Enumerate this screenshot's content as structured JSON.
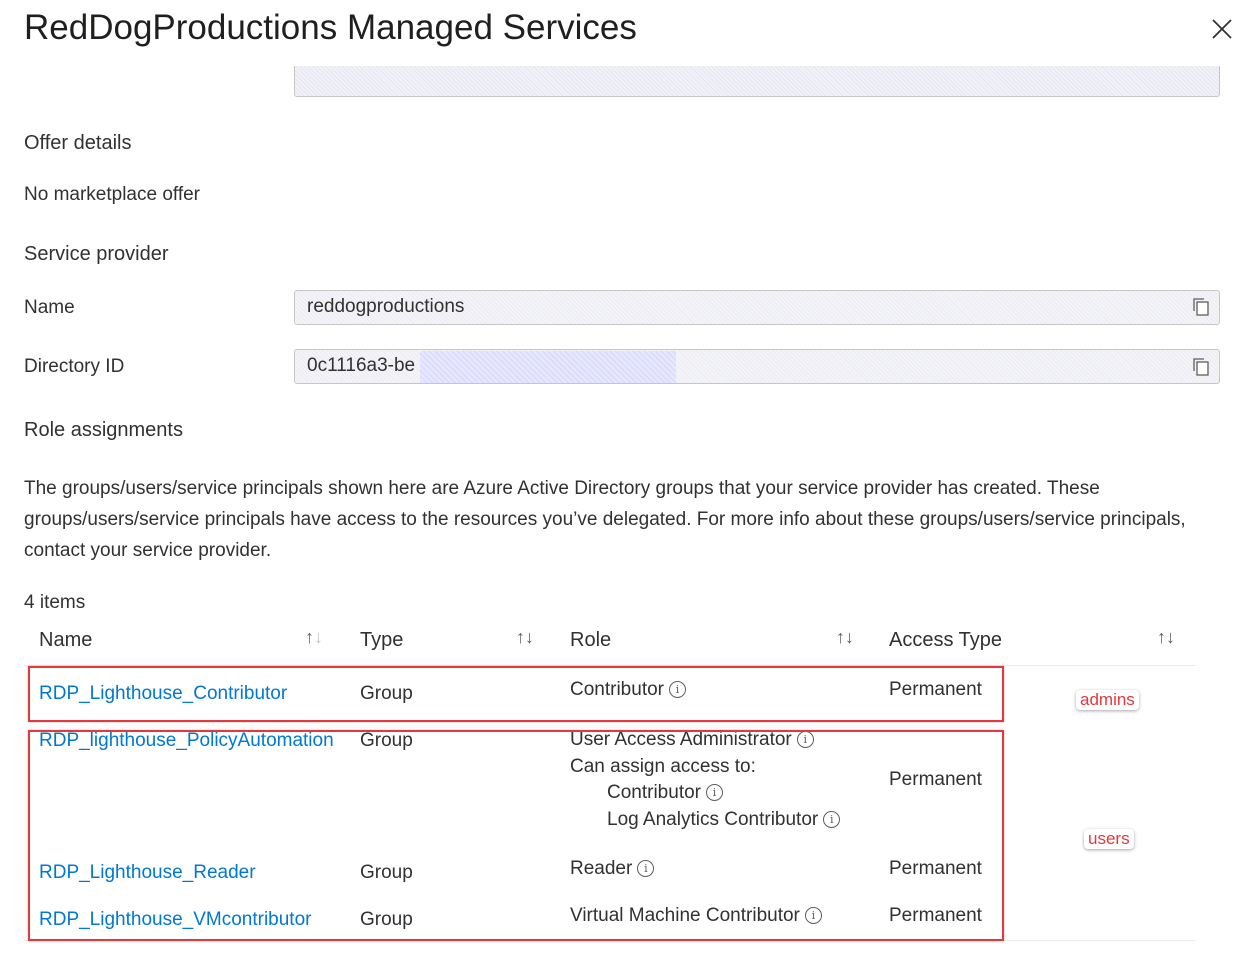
{
  "panel": {
    "title": "RedDogProductions Managed Services",
    "clipped_label": ""
  },
  "offer": {
    "heading": "Offer details",
    "text": "No marketplace offer"
  },
  "provider": {
    "heading": "Service provider",
    "name_label": "Name",
    "name_value": "reddogproductions",
    "directory_label": "Directory ID",
    "directory_value": "0c1116a3-be"
  },
  "roles": {
    "heading": "Role assignments",
    "description": "The groups/users/service principals shown here are Azure Active Directory groups that your service provider has created. These groups/users/service principals have access to the resources you’ve delegated. For more info about these groups/users/service principals, contact your service provider.",
    "count": "4 items",
    "columns": {
      "name": "Name",
      "type": "Type",
      "role": "Role",
      "access": "Access Type"
    },
    "rows": [
      {
        "name": "RDP_Lighthouse_Contributor",
        "type": "Group",
        "role": "Contributor",
        "access": "Permanent"
      },
      {
        "name": "RDP_lighthouse_PolicyAutomation",
        "type": "Group",
        "role": "User Access Administrator",
        "assign_label": "Can assign access to:",
        "assign_1": "Contributor",
        "assign_2": "Log Analytics Contributor",
        "access": "Permanent"
      },
      {
        "name": "RDP_Lighthouse_Reader",
        "type": "Group",
        "role": "Reader",
        "access": "Permanent"
      },
      {
        "name": "RDP_Lighthouse_VMcontributor",
        "type": "Group",
        "role": "Virtual Machine Contributor",
        "access": "Permanent"
      }
    ]
  },
  "annotations": {
    "admins": "admins",
    "users": "users",
    "color": "#e0393e"
  },
  "icons": {
    "close": "close-icon",
    "copy": "copy-icon",
    "info": "info-icon",
    "sort": "sort-icon"
  },
  "colors": {
    "link": "#0078d4",
    "text": "#323130"
  }
}
